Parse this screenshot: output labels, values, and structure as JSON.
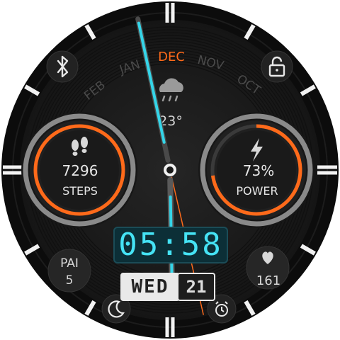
{
  "months": {
    "feb": "FEB",
    "jan": "JAN",
    "dec": "DEC",
    "nov": "NOV",
    "oct": "OCT"
  },
  "weather": {
    "icon": "cloud-rain-icon",
    "temperature": "23°"
  },
  "steps": {
    "value": "7296",
    "label": "STEPS",
    "icon": "footprints-icon"
  },
  "power": {
    "value": "73%",
    "label": "POWER",
    "icon": "lightning-icon",
    "level": 0.73
  },
  "time": {
    "digital": "05:58",
    "hour": 5,
    "minute": 58
  },
  "date": {
    "weekday": "WED",
    "day": "21"
  },
  "pai": {
    "label": "PAI",
    "value": "5"
  },
  "heart": {
    "value": "161",
    "icon": "heart-icon"
  },
  "icons": {
    "bluetooth": "bluetooth-icon",
    "lock": "lock-icon",
    "moon": "moon-icon",
    "alarm": "alarm-icon"
  },
  "colors": {
    "accent_orange": "#ff6a1a",
    "accent_cyan": "#35d5e8",
    "bezel": "#0e0e0e"
  }
}
